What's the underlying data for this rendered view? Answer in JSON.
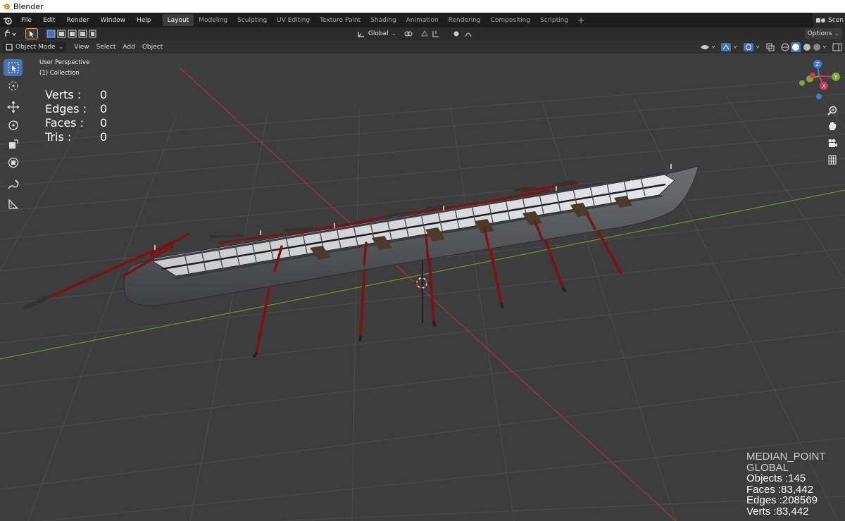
{
  "window": {
    "title": "Blender"
  },
  "menubar": {
    "items": [
      "File",
      "Edit",
      "Render",
      "Window",
      "Help"
    ]
  },
  "workspaces": {
    "tabs": [
      "Layout",
      "Modeling",
      "Sculpting",
      "UV Editing",
      "Texture Paint",
      "Shading",
      "Animation",
      "Rendering",
      "Compositing",
      "Scripting"
    ],
    "active": "Layout",
    "add_label": "+"
  },
  "scene": {
    "label": "Scen"
  },
  "toolheader": {
    "orientation": "Global",
    "options_label": "Options"
  },
  "viewport_header": {
    "mode": "Object Mode",
    "menus": [
      "View",
      "Select",
      "Add",
      "Object"
    ]
  },
  "viewport": {
    "perspective_label": "User Perspective",
    "collection_label": "(1) Collection",
    "stats": [
      {
        "label": "Verts :",
        "value": "0"
      },
      {
        "label": "Edges :",
        "value": "0"
      },
      {
        "label": "Faces :",
        "value": "0"
      },
      {
        "label": "Tris :",
        "value": "0"
      }
    ],
    "overlay_info": {
      "pivot": "MEDIAN_POINT",
      "orientation": "GLOBAL",
      "objects": "Objects :145",
      "faces": "Faces :83,442",
      "edges": "Edges :208569",
      "verts": "Verts :83,442"
    },
    "gizmo": {
      "x": "X",
      "y": "Y",
      "z": "Z"
    }
  },
  "colors": {
    "accent": "#4772b3",
    "axis_x": "#d03b4f",
    "axis_y": "#7da73a",
    "axis_z": "#3a7fe0",
    "oar": "#7a1414",
    "hull": "#5a5c60"
  },
  "icons": {
    "blender": "blender-logo-icon",
    "select_box": "select-box-icon",
    "cursor": "cursor-icon",
    "move": "move-icon",
    "rotate": "rotate-icon",
    "scale": "scale-icon",
    "transform": "transform-icon",
    "annotate": "annotate-icon",
    "measure": "measure-icon",
    "zoom": "zoom-icon",
    "pan": "pan-hand-icon",
    "camera": "camera-icon",
    "grid": "ortho-grid-icon"
  }
}
